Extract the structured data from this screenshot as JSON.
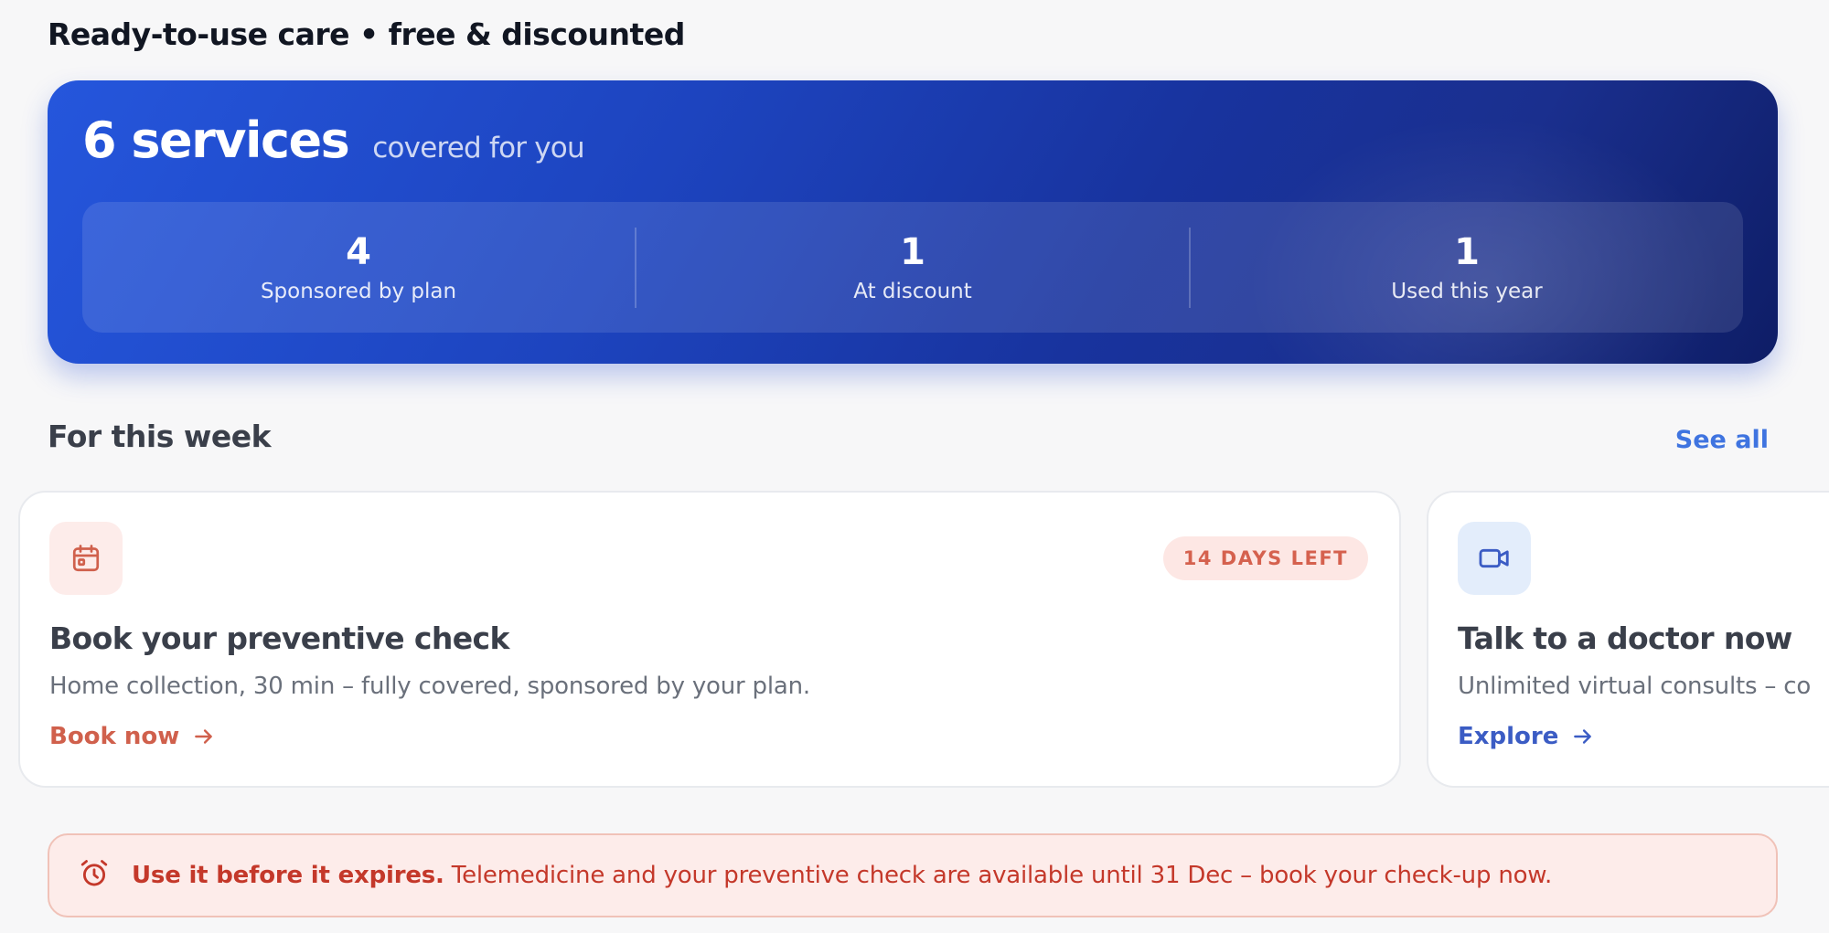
{
  "page": {
    "heading": "Ready-to-use care • free & discounted"
  },
  "hero": {
    "count": "6 services",
    "subtitle": "covered for you",
    "stats": [
      {
        "value": "4",
        "label": "Sponsored by plan"
      },
      {
        "value": "1",
        "label": "At discount"
      },
      {
        "value": "1",
        "label": "Used this year"
      }
    ]
  },
  "section": {
    "title": "For this week",
    "see_all": "See all"
  },
  "cards": [
    {
      "icon": "calendar-icon",
      "badge": "14 DAYS LEFT",
      "title": "Book your preventive check",
      "description": "Home collection, 30 min – fully covered, sponsored by your plan.",
      "cta": "Book now"
    },
    {
      "icon": "video-camera-icon",
      "title": "Talk to a doctor now",
      "description": "Unlimited virtual consults – co",
      "cta": "Explore"
    }
  ],
  "alert": {
    "icon": "alarm-clock-icon",
    "strong": "Use it before it expires.",
    "text": " Telemedicine and your preventive check are available until 31 Dec – book your check-up now."
  },
  "colors": {
    "hero_start": "#2556dc",
    "hero_end": "#0e1d66",
    "accent_blue": "#3f74e0",
    "accent_red": "#d0604c",
    "alert_bg": "#fdecea"
  }
}
